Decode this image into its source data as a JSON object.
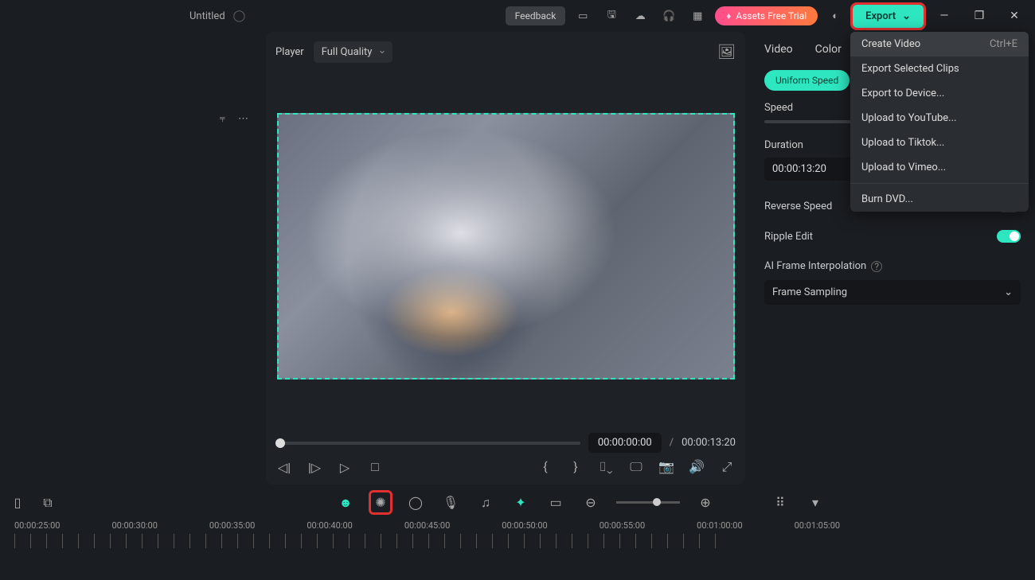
{
  "titlebar": {
    "project_name": "Untitled",
    "feedback": "Feedback",
    "assets_trial": "Assets Free Trial",
    "export": "Export"
  },
  "export_menu": {
    "items": [
      {
        "label": "Create Video",
        "shortcut": "Ctrl+E"
      },
      {
        "label": "Export Selected Clips"
      },
      {
        "label": "Export to Device..."
      },
      {
        "label": "Upload to YouTube..."
      },
      {
        "label": "Upload to Tiktok..."
      },
      {
        "label": "Upload to Vimeo..."
      }
    ],
    "burn": "Burn DVD..."
  },
  "preview": {
    "player_label": "Player",
    "quality": "Full Quality",
    "current_time": "00:00:00:00",
    "total_time": "00:00:13:20"
  },
  "inspector": {
    "tabs": {
      "video": "Video",
      "color": "Color"
    },
    "uniform_speed": "Uniform Speed",
    "speed_label": "Speed",
    "duration_label": "Duration",
    "duration_value": "00:00:13:20",
    "reverse_label": "Reverse Speed",
    "ripple_label": "Ripple Edit",
    "ai_label": "AI Frame Interpolation",
    "frame_sampling": "Frame Sampling"
  },
  "timeline": {
    "marks": [
      "00:00:25:00",
      "00:00:30:00",
      "00:00:35:00",
      "00:00:40:00",
      "00:00:45:00",
      "00:00:50:00",
      "00:00:55:00",
      "00:01:00:00",
      "00:01:05:00"
    ]
  }
}
